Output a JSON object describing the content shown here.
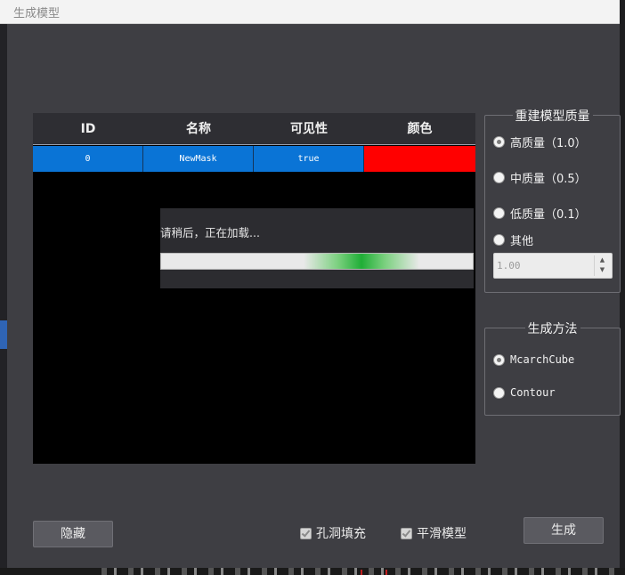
{
  "window": {
    "title": "生成模型"
  },
  "table": {
    "headers": [
      "ID",
      "名称",
      "可见性",
      "颜色"
    ],
    "rows": [
      {
        "id": "0",
        "name": "NewMask",
        "visible": "true",
        "color": "#ff0000"
      }
    ]
  },
  "loading": {
    "message": "请稍后，正在加载..."
  },
  "quality": {
    "legend": "重建模型质量",
    "options": [
      "高质量（1.0）",
      "中质量（0.5）",
      "低质量（0.1）",
      "其他"
    ],
    "selected": 0,
    "custom_value": "1.00"
  },
  "method": {
    "legend": "生成方法",
    "options": [
      "McarchCube",
      "Contour"
    ],
    "selected": 0
  },
  "footer": {
    "hide_label": "隐藏",
    "fill_holes_label": "孔洞填充",
    "fill_holes_checked": true,
    "smooth_label": "平滑模型",
    "smooth_checked": true,
    "generate_label": "生成"
  },
  "colors": {
    "dialog_bg": "#3e3e43",
    "selection": "#0a74d6",
    "mask_color": "#ff0000",
    "progress": "#1fae36"
  }
}
